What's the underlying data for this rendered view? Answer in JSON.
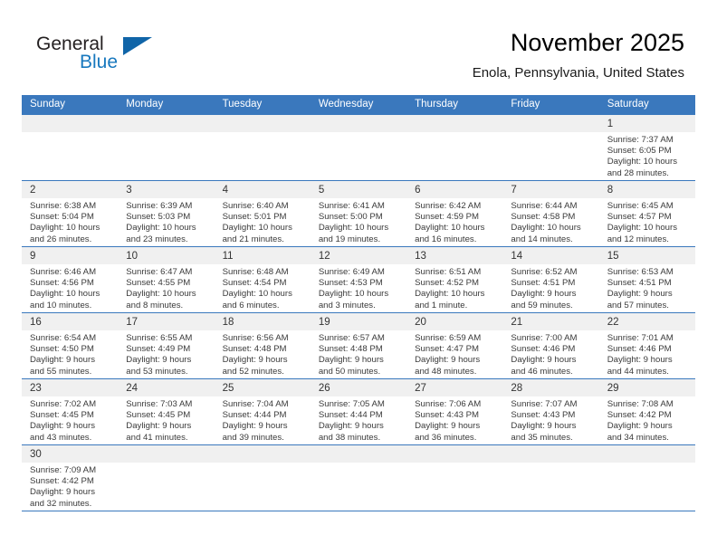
{
  "brand": {
    "name_part1": "General",
    "name_part2": "Blue",
    "accent_color": "#1065a8",
    "triangle_icon": "triangle-icon"
  },
  "header": {
    "title": "November 2025",
    "location": "Enola, Pennsylvania, United States"
  },
  "calendar": {
    "header_bg": "#3a78bd",
    "daynum_bg": "#f0f0f0",
    "weekday_headers": [
      "Sunday",
      "Monday",
      "Tuesday",
      "Wednesday",
      "Thursday",
      "Friday",
      "Saturday"
    ],
    "weeks": [
      [
        {
          "empty": true
        },
        {
          "empty": true
        },
        {
          "empty": true
        },
        {
          "empty": true
        },
        {
          "empty": true
        },
        {
          "empty": true
        },
        {
          "day": "1",
          "sunrise": "Sunrise: 7:37 AM",
          "sunset": "Sunset: 6:05 PM",
          "daylight1": "Daylight: 10 hours",
          "daylight2": "and 28 minutes."
        }
      ],
      [
        {
          "day": "2",
          "sunrise": "Sunrise: 6:38 AM",
          "sunset": "Sunset: 5:04 PM",
          "daylight1": "Daylight: 10 hours",
          "daylight2": "and 26 minutes."
        },
        {
          "day": "3",
          "sunrise": "Sunrise: 6:39 AM",
          "sunset": "Sunset: 5:03 PM",
          "daylight1": "Daylight: 10 hours",
          "daylight2": "and 23 minutes."
        },
        {
          "day": "4",
          "sunrise": "Sunrise: 6:40 AM",
          "sunset": "Sunset: 5:01 PM",
          "daylight1": "Daylight: 10 hours",
          "daylight2": "and 21 minutes."
        },
        {
          "day": "5",
          "sunrise": "Sunrise: 6:41 AM",
          "sunset": "Sunset: 5:00 PM",
          "daylight1": "Daylight: 10 hours",
          "daylight2": "and 19 minutes."
        },
        {
          "day": "6",
          "sunrise": "Sunrise: 6:42 AM",
          "sunset": "Sunset: 4:59 PM",
          "daylight1": "Daylight: 10 hours",
          "daylight2": "and 16 minutes."
        },
        {
          "day": "7",
          "sunrise": "Sunrise: 6:44 AM",
          "sunset": "Sunset: 4:58 PM",
          "daylight1": "Daylight: 10 hours",
          "daylight2": "and 14 minutes."
        },
        {
          "day": "8",
          "sunrise": "Sunrise: 6:45 AM",
          "sunset": "Sunset: 4:57 PM",
          "daylight1": "Daylight: 10 hours",
          "daylight2": "and 12 minutes."
        }
      ],
      [
        {
          "day": "9",
          "sunrise": "Sunrise: 6:46 AM",
          "sunset": "Sunset: 4:56 PM",
          "daylight1": "Daylight: 10 hours",
          "daylight2": "and 10 minutes."
        },
        {
          "day": "10",
          "sunrise": "Sunrise: 6:47 AM",
          "sunset": "Sunset: 4:55 PM",
          "daylight1": "Daylight: 10 hours",
          "daylight2": "and 8 minutes."
        },
        {
          "day": "11",
          "sunrise": "Sunrise: 6:48 AM",
          "sunset": "Sunset: 4:54 PM",
          "daylight1": "Daylight: 10 hours",
          "daylight2": "and 6 minutes."
        },
        {
          "day": "12",
          "sunrise": "Sunrise: 6:49 AM",
          "sunset": "Sunset: 4:53 PM",
          "daylight1": "Daylight: 10 hours",
          "daylight2": "and 3 minutes."
        },
        {
          "day": "13",
          "sunrise": "Sunrise: 6:51 AM",
          "sunset": "Sunset: 4:52 PM",
          "daylight1": "Daylight: 10 hours",
          "daylight2": "and 1 minute."
        },
        {
          "day": "14",
          "sunrise": "Sunrise: 6:52 AM",
          "sunset": "Sunset: 4:51 PM",
          "daylight1": "Daylight: 9 hours",
          "daylight2": "and 59 minutes."
        },
        {
          "day": "15",
          "sunrise": "Sunrise: 6:53 AM",
          "sunset": "Sunset: 4:51 PM",
          "daylight1": "Daylight: 9 hours",
          "daylight2": "and 57 minutes."
        }
      ],
      [
        {
          "day": "16",
          "sunrise": "Sunrise: 6:54 AM",
          "sunset": "Sunset: 4:50 PM",
          "daylight1": "Daylight: 9 hours",
          "daylight2": "and 55 minutes."
        },
        {
          "day": "17",
          "sunrise": "Sunrise: 6:55 AM",
          "sunset": "Sunset: 4:49 PM",
          "daylight1": "Daylight: 9 hours",
          "daylight2": "and 53 minutes."
        },
        {
          "day": "18",
          "sunrise": "Sunrise: 6:56 AM",
          "sunset": "Sunset: 4:48 PM",
          "daylight1": "Daylight: 9 hours",
          "daylight2": "and 52 minutes."
        },
        {
          "day": "19",
          "sunrise": "Sunrise: 6:57 AM",
          "sunset": "Sunset: 4:48 PM",
          "daylight1": "Daylight: 9 hours",
          "daylight2": "and 50 minutes."
        },
        {
          "day": "20",
          "sunrise": "Sunrise: 6:59 AM",
          "sunset": "Sunset: 4:47 PM",
          "daylight1": "Daylight: 9 hours",
          "daylight2": "and 48 minutes."
        },
        {
          "day": "21",
          "sunrise": "Sunrise: 7:00 AM",
          "sunset": "Sunset: 4:46 PM",
          "daylight1": "Daylight: 9 hours",
          "daylight2": "and 46 minutes."
        },
        {
          "day": "22",
          "sunrise": "Sunrise: 7:01 AM",
          "sunset": "Sunset: 4:46 PM",
          "daylight1": "Daylight: 9 hours",
          "daylight2": "and 44 minutes."
        }
      ],
      [
        {
          "day": "23",
          "sunrise": "Sunrise: 7:02 AM",
          "sunset": "Sunset: 4:45 PM",
          "daylight1": "Daylight: 9 hours",
          "daylight2": "and 43 minutes."
        },
        {
          "day": "24",
          "sunrise": "Sunrise: 7:03 AM",
          "sunset": "Sunset: 4:45 PM",
          "daylight1": "Daylight: 9 hours",
          "daylight2": "and 41 minutes."
        },
        {
          "day": "25",
          "sunrise": "Sunrise: 7:04 AM",
          "sunset": "Sunset: 4:44 PM",
          "daylight1": "Daylight: 9 hours",
          "daylight2": "and 39 minutes."
        },
        {
          "day": "26",
          "sunrise": "Sunrise: 7:05 AM",
          "sunset": "Sunset: 4:44 PM",
          "daylight1": "Daylight: 9 hours",
          "daylight2": "and 38 minutes."
        },
        {
          "day": "27",
          "sunrise": "Sunrise: 7:06 AM",
          "sunset": "Sunset: 4:43 PM",
          "daylight1": "Daylight: 9 hours",
          "daylight2": "and 36 minutes."
        },
        {
          "day": "28",
          "sunrise": "Sunrise: 7:07 AM",
          "sunset": "Sunset: 4:43 PM",
          "daylight1": "Daylight: 9 hours",
          "daylight2": "and 35 minutes."
        },
        {
          "day": "29",
          "sunrise": "Sunrise: 7:08 AM",
          "sunset": "Sunset: 4:42 PM",
          "daylight1": "Daylight: 9 hours",
          "daylight2": "and 34 minutes."
        }
      ],
      [
        {
          "day": "30",
          "sunrise": "Sunrise: 7:09 AM",
          "sunset": "Sunset: 4:42 PM",
          "daylight1": "Daylight: 9 hours",
          "daylight2": "and 32 minutes."
        },
        {
          "empty": true
        },
        {
          "empty": true
        },
        {
          "empty": true
        },
        {
          "empty": true
        },
        {
          "empty": true
        },
        {
          "empty": true
        }
      ]
    ]
  }
}
